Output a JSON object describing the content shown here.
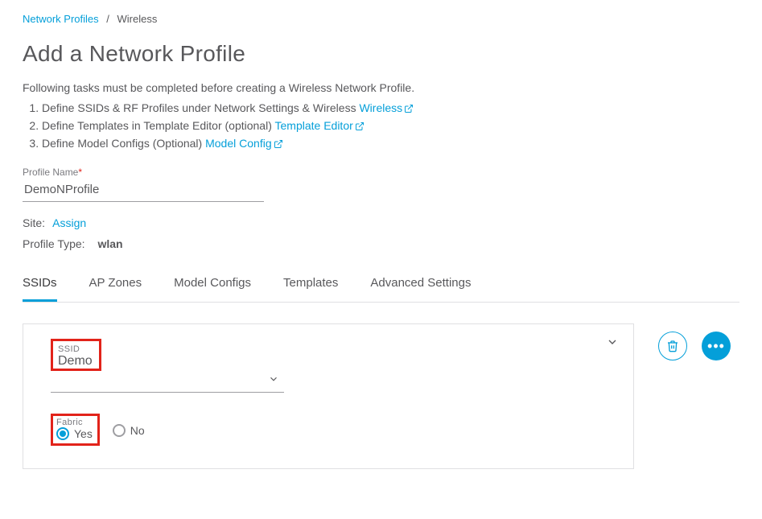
{
  "breadcrumb": {
    "root": "Network Profiles",
    "current": "Wireless"
  },
  "page_title": "Add a Network Profile",
  "intro": "Following tasks must be completed before creating a Wireless Network Profile.",
  "tasks": [
    {
      "text": "Define SSIDs & RF Profiles under Network Settings & Wireless",
      "link": "Wireless"
    },
    {
      "text": "Define Templates in Template Editor (optional)",
      "link": "Template Editor"
    },
    {
      "text": "Define Model Configs (Optional)",
      "link": "Model Config"
    }
  ],
  "profile_name": {
    "label": "Profile Name",
    "value": "DemoNProfile"
  },
  "site": {
    "label": "Site:",
    "action": "Assign"
  },
  "profile_type": {
    "label": "Profile Type:",
    "value": "wlan"
  },
  "tabs": [
    "SSIDs",
    "AP Zones",
    "Model Configs",
    "Templates",
    "Advanced Settings"
  ],
  "ssid_card": {
    "ssid_label": "SSID",
    "ssid_value": "Demo",
    "fabric_label": "Fabric",
    "fabric_options": {
      "yes": "Yes",
      "no": "No"
    }
  }
}
